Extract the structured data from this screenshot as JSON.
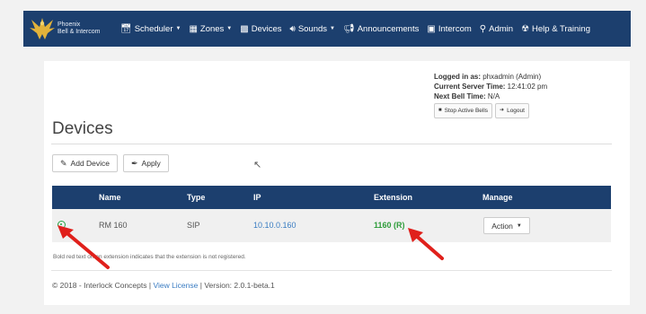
{
  "brand": {
    "line1": "Phoenix",
    "line2": "Bell & Intercom"
  },
  "nav": [
    {
      "icon": "calendar-icon",
      "label": "Scheduler",
      "dropdown": true
    },
    {
      "icon": "zones-icon",
      "label": "Zones",
      "dropdown": true
    },
    {
      "icon": "devices-icon",
      "label": "Devices",
      "dropdown": false
    },
    {
      "icon": "speaker-icon",
      "label": "Sounds",
      "dropdown": true
    },
    {
      "icon": "megaphone-icon",
      "label": "Announcements",
      "dropdown": false
    },
    {
      "icon": "intercom-icon",
      "label": "Intercom",
      "dropdown": false
    },
    {
      "icon": "user-icon",
      "label": "Admin",
      "dropdown": false
    },
    {
      "icon": "help-icon",
      "label": "Help & Training",
      "dropdown": false
    }
  ],
  "user_info": {
    "logged_in_label": "Logged in as:",
    "logged_in_value": "phxadmin (Admin)",
    "server_time_label": "Current Server Time:",
    "server_time_value": "12:41:02 pm",
    "next_bell_label": "Next Bell Time:",
    "next_bell_value": "N/A",
    "stop_bells": "Stop Active Bells",
    "logout": "Logout"
  },
  "page_title": "Devices",
  "toolbar": {
    "add_device": "Add Device",
    "apply": "Apply"
  },
  "table": {
    "columns": [
      "Name",
      "Type",
      "IP",
      "Extension",
      "Manage"
    ],
    "rows": [
      {
        "status": "registered",
        "name": "RM 160",
        "type": "SIP",
        "ip": "10.10.0.160",
        "extension": "1160 (R)",
        "action": "Action"
      }
    ]
  },
  "note": "Bold red text on an extension indicates that the extension is not registered.",
  "footer": {
    "copyright": "© 2018 - Interlock Concepts |",
    "license_link": "View License",
    "version": "| Version: 2.0.1-beta.1"
  },
  "colors": {
    "navbar": "#1c3f6e",
    "link": "#3a7cc2",
    "registered": "#2e9c3a",
    "arrow": "#e0201b"
  }
}
